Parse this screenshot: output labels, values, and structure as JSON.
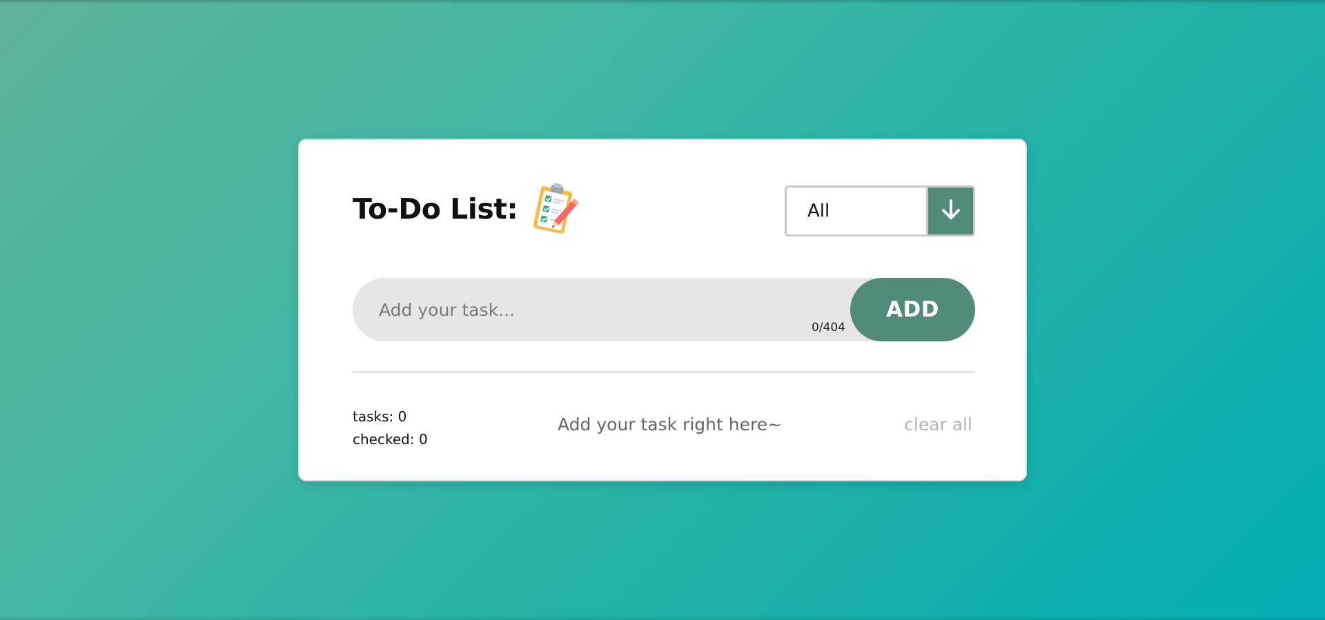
{
  "app": {
    "title": "To-Do List:",
    "title_icon": "clipboard-checklist-icon"
  },
  "filter": {
    "selected": "All",
    "button_icon": "arrow-down-icon"
  },
  "task_input": {
    "placeholder": "Add your task...",
    "value": "",
    "char_count": "0/404"
  },
  "add_button": {
    "label": "ADD"
  },
  "footer": {
    "tasks_label": "tasks: 0",
    "checked_label": "checked: 0",
    "hint": "Add your task right here~",
    "clear_label": "clear all"
  },
  "colors": {
    "accent": "#528b79",
    "background_start": "#5fb39a",
    "background_end": "#05adb3",
    "input_bg": "#e6e6e6",
    "muted_text": "#b3b3b3"
  }
}
